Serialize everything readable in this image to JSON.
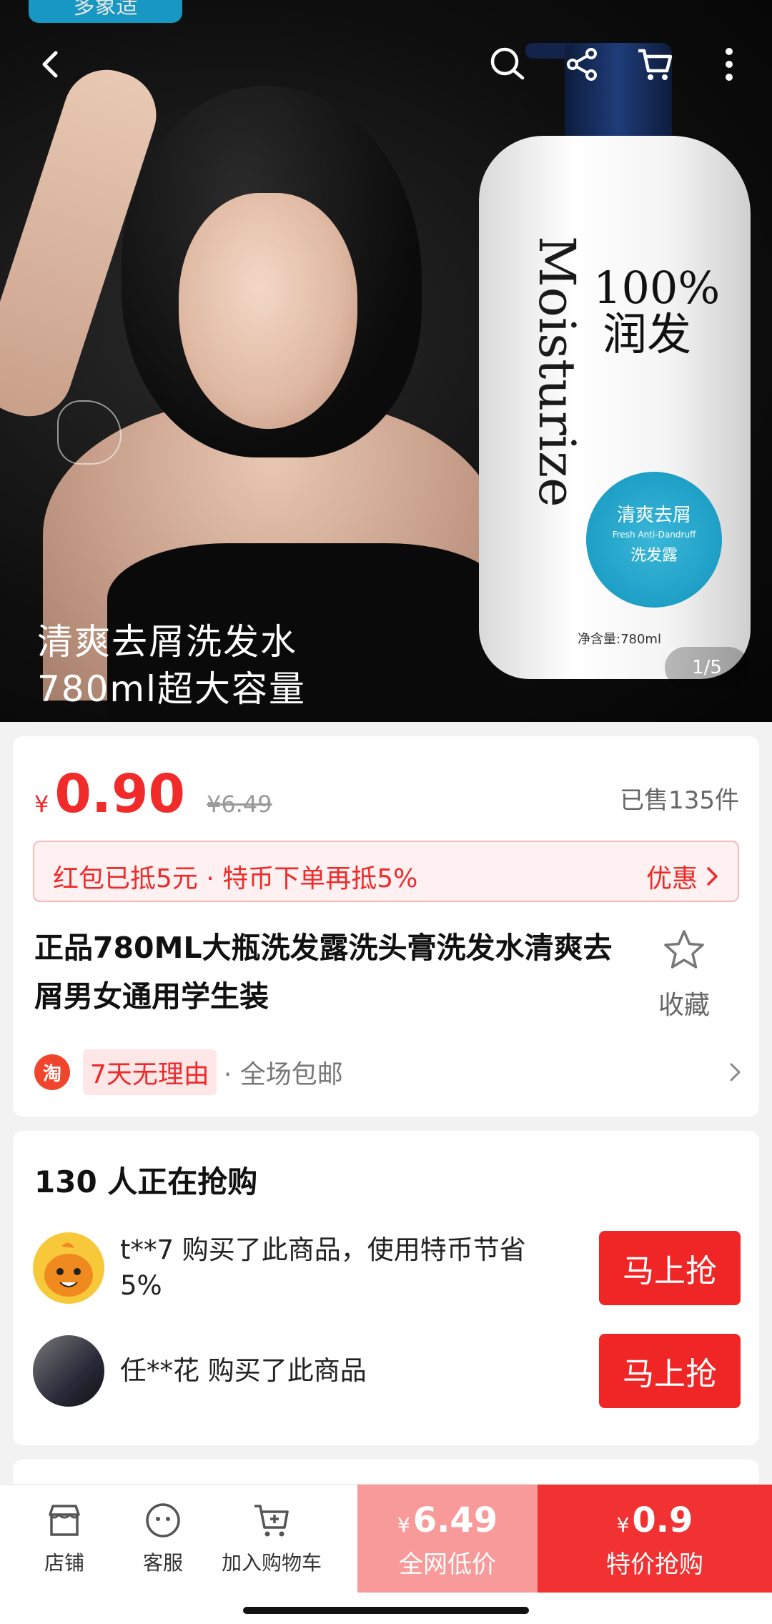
{
  "hero": {
    "brand_tag": "多象适",
    "caption_line1": "清爽去屑洗发水",
    "caption_line2": "780ml超大容量",
    "page_indicator": "1/5",
    "bottle": {
      "label_big": "100%润发",
      "script": "Moisturize",
      "circle_line1": "清爽去屑",
      "circle_line2": "Fresh Anti-Dandruff",
      "circle_line3": "洗发露",
      "volume": "净含量:780ml"
    }
  },
  "topbar": {
    "icons": [
      "back-icon",
      "search-icon",
      "share-icon",
      "cart-icon",
      "more-icon"
    ]
  },
  "product": {
    "currency": "¥",
    "price": "0.90",
    "original_price": "¥6.49",
    "sold": "已售135件",
    "coupon_text": "红包已抵5元 · 特币下单再抵5%",
    "coupon_more": "优惠",
    "title": "正品780ML大瓶洗发露洗头膏洗发水清爽去屑男女通用学生装",
    "favorite_label": "收藏",
    "service_logo": "淘",
    "service_tag": "7天无理由",
    "service_text": "· 全场包邮"
  },
  "buyers": {
    "title": "130 人正在抢购",
    "items": [
      {
        "text": "t**7 购买了此商品，使用特币节省5%",
        "button": "马上抢"
      },
      {
        "text": "任**花 购买了此商品",
        "button": "马上抢"
      }
    ]
  },
  "bottom_bar": {
    "tabs": [
      {
        "label": "店铺",
        "icon": "store-icon"
      },
      {
        "label": "客服",
        "icon": "chat-icon"
      },
      {
        "label": "加入购物车",
        "icon": "add-cart-icon"
      }
    ],
    "low_price": {
      "currency": "¥",
      "value": "6.49",
      "label": "全网低价"
    },
    "buy_now": {
      "currency": "¥",
      "value": "0.9",
      "label": "特价抢购"
    }
  },
  "colors": {
    "accent": "#f12a2a",
    "low_price_bg": "#f99a9a",
    "buy_now_bg": "#f23232",
    "coupon_bg": "#fff1f1"
  }
}
